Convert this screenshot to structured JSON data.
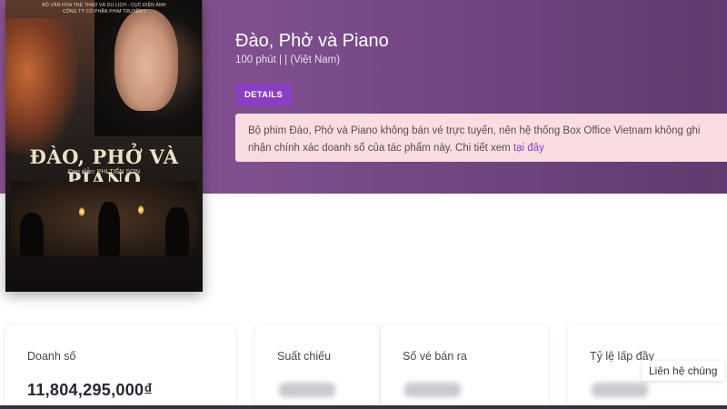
{
  "poster": {
    "credit_top": "BỘ VĂN HÓA THỂ THAO VÀ DU LỊCH - CỤC ĐIỆN ẢNH\nCÔNG TY CỔ PHẦN PHIM TRUYỆN I",
    "title": "ĐÀO, PHỞ VÀ PIANO",
    "director": "Đạo diễn: PHI TIẾN SƠN"
  },
  "movie": {
    "title": "Đào, Phở và Piano",
    "meta": "100 phút  |   | (Việt Nam)"
  },
  "details_button": {
    "label": "DETAILS"
  },
  "notice": {
    "text": "Bộ phim Đào, Phở và Piano không bán vé trực tuyến, nên hệ thống Box Office Vietnam không ghi nhận chính xác doanh số của tác phẩm này. Chi tiết xem ",
    "link_label": "tại đây"
  },
  "stats": [
    {
      "label": "Doanh số",
      "value": "11,804,295,000₫"
    },
    {
      "label": "Suất chiếu",
      "value": ""
    },
    {
      "label": "Số vé bán ra",
      "value": ""
    },
    {
      "label": "Tỷ lệ lấp đầy",
      "value": ""
    }
  ],
  "contact": {
    "label": "Liên hệ chúng"
  },
  "colors": {
    "hero_start": "#8f5597",
    "hero_end": "#5e3b70",
    "accent": "#8a3fc2",
    "notice_bg": "#f9dde2"
  }
}
